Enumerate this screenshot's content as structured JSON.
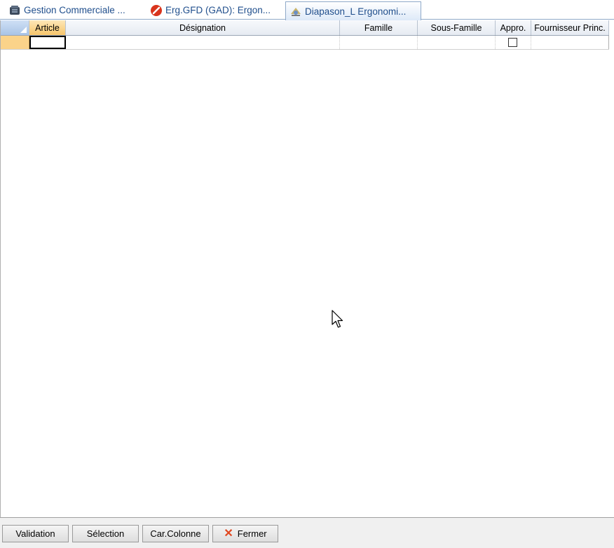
{
  "tabs": [
    {
      "label": "Gestion Commerciale ...",
      "icon": "database-icon",
      "active": false
    },
    {
      "label": "Erg.GFD (GAD): Ergon...",
      "icon": "no-entry-icon",
      "active": false
    },
    {
      "label": "Diapason_L Ergonomi...",
      "icon": "diapason-icon",
      "active": true
    }
  ],
  "grid": {
    "columns": [
      "Article",
      "Désignation",
      "Famille",
      "Sous-Famille",
      "Appro.",
      "Fournisseur Princ."
    ],
    "rows": [
      {
        "article": "",
        "designation": "",
        "famille": "",
        "sous_famille": "",
        "appro": false,
        "fournisseur": ""
      }
    ]
  },
  "buttons": {
    "validation": "Validation",
    "selection": "Sélection",
    "car_colonne": "Car.Colonne",
    "fermer": "Fermer"
  },
  "colors": {
    "tab_text": "#1f4e8c",
    "selected_header": "#f7c66b",
    "row_indicator": "#fbd38a",
    "close_icon": "#e0461e"
  }
}
